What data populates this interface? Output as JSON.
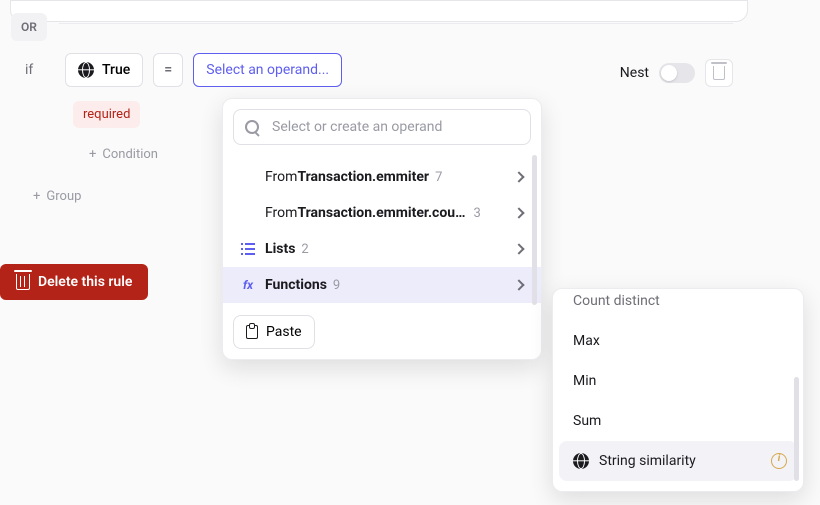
{
  "rule": {
    "or_label": "OR",
    "if_label": "if",
    "true_value": "True",
    "operator": "=",
    "select_operand_label": "Select an operand...",
    "nest_label": "Nest",
    "required_label": "required",
    "add_condition_label": "Condition",
    "add_group_label": "Group"
  },
  "delete_rule_label": "Delete this rule",
  "operand_dd": {
    "search_placeholder": "Select or create an operand",
    "from_prefix": "From ",
    "items": [
      {
        "bold": "Transaction.emmiter",
        "count": "7"
      },
      {
        "bold": "Transaction.emmiter.country",
        "count": "3"
      }
    ],
    "lists": {
      "label": "Lists",
      "count": "2"
    },
    "functions": {
      "label": "Functions",
      "count": "9"
    },
    "paste_label": "Paste"
  },
  "functions_dd": {
    "items": [
      {
        "label": "Count distinct"
      },
      {
        "label": "Max"
      },
      {
        "label": "Min"
      },
      {
        "label": "Sum"
      },
      {
        "label": "String similarity",
        "highlight": true,
        "globe": true,
        "info": true
      }
    ]
  }
}
